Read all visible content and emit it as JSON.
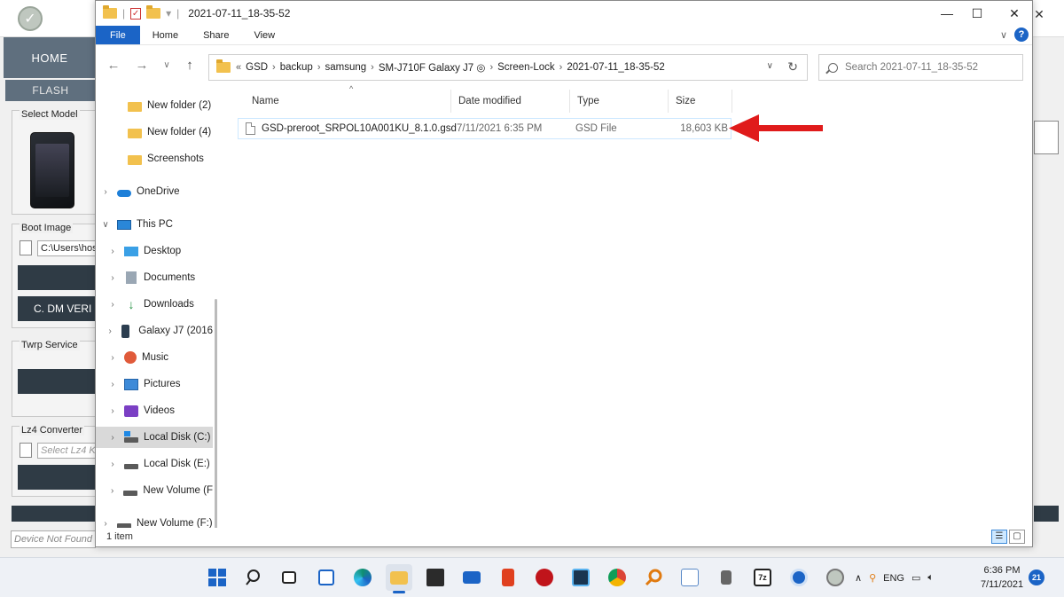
{
  "background_app": {
    "home_label": "HOME",
    "flash_label": "FLASH",
    "select_model_label": "Select Model",
    "boot_image_label": "Boot Image",
    "boot_image_path": "C:\\Users\\hos",
    "dm_verity_button": "C. DM VERI",
    "twrp_label": "Twrp Service",
    "lz4_label": "Lz4 Converter",
    "lz4_placeholder": "Select Lz4 Ke",
    "device_status": "Device Not Found"
  },
  "window": {
    "title": "2021-07-11_18-35-52",
    "minimize": "—",
    "maximize": "☐",
    "close": "✕"
  },
  "ribbon": {
    "tabs": [
      {
        "label": "File"
      },
      {
        "label": "Home"
      },
      {
        "label": "Share"
      },
      {
        "label": "View"
      }
    ],
    "help": "?"
  },
  "address": {
    "overflow": "«",
    "crumbs": [
      "GSD",
      "backup",
      "samsung",
      "SM-J710F Galaxy J7 ◎",
      "Screen-Lock",
      "2021-07-11_18-35-52"
    ]
  },
  "search": {
    "placeholder": "Search 2021-07-11_18-35-52"
  },
  "nav_tree": [
    {
      "label": "New folder (2)",
      "icon": "folder-icon"
    },
    {
      "label": "New folder (4)",
      "icon": "folder-icon"
    },
    {
      "label": "Screenshots",
      "icon": "folder-icon"
    },
    {
      "label": "OneDrive",
      "icon": "cloud-icon"
    },
    {
      "label": "This PC",
      "icon": "pc-icon"
    },
    {
      "label": "Desktop",
      "icon": "desktop-icon"
    },
    {
      "label": "Documents",
      "icon": "documents-icon"
    },
    {
      "label": "Downloads",
      "icon": "download-icon"
    },
    {
      "label": "Galaxy J7 (2016",
      "icon": "phone-icon"
    },
    {
      "label": "Music",
      "icon": "music-icon"
    },
    {
      "label": "Pictures",
      "icon": "pictures-icon"
    },
    {
      "label": "Videos",
      "icon": "videos-icon"
    },
    {
      "label": "Local Disk (C:)",
      "icon": "disk-icon"
    },
    {
      "label": "Local Disk (E:)",
      "icon": "disk-icon"
    },
    {
      "label": "New Volume (F",
      "icon": "disk-icon"
    },
    {
      "label": "New Volume (F:)",
      "icon": "disk-icon"
    }
  ],
  "columns": {
    "name": "Name",
    "date": "Date modified",
    "type": "Type",
    "size": "Size"
  },
  "files": [
    {
      "name": "GSD-preroot_SRPOL10A001KU_8.1.0.gsd",
      "date": "7/11/2021 6:35 PM",
      "type": "GSD File",
      "size": "18,603 KB"
    }
  ],
  "status": {
    "item_count": "1 item"
  },
  "tray": {
    "language": "ENG",
    "time": "6:36 PM",
    "date": "7/11/2021",
    "notifications": "21"
  },
  "colors": {
    "accent": "#1b64c6",
    "arrow": "#e01b1b",
    "selection": "#cde8ff"
  }
}
